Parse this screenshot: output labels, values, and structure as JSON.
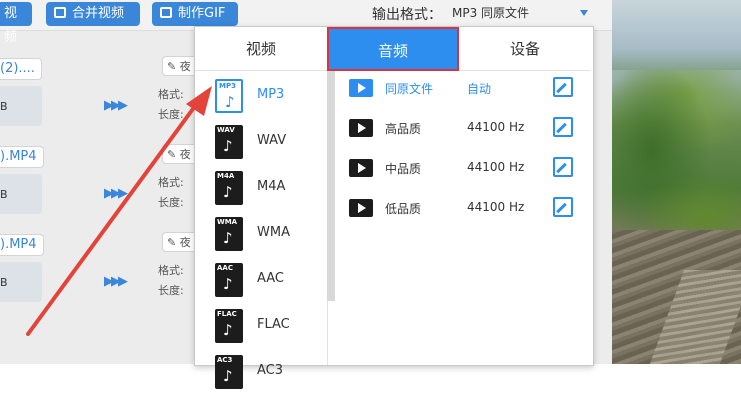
{
  "toolbar": {
    "btn_video": "视频",
    "btn_merge": "合并视频",
    "btn_gif": "制作GIF",
    "output_format_label": "输出格式：",
    "output_format_value": "MP3  同原文件"
  },
  "files": [
    {
      "name": "(2)....",
      "size": "B",
      "format_label": "格式:",
      "duration_label": "长度:",
      "edit": "夜"
    },
    {
      "name": ").MP4",
      "size": "B",
      "format_label": "格式:",
      "duration_label": "长度:",
      "edit": "夜"
    },
    {
      "name": ").MP4",
      "size": "B",
      "format_label": "格式:",
      "duration_label": "长度:",
      "edit": "夜"
    }
  ],
  "popup": {
    "tabs": [
      "视频",
      "音频",
      "设备"
    ],
    "active_tab": "音频",
    "formats": [
      {
        "tag": "MP3",
        "label": "MP3",
        "selected": true
      },
      {
        "tag": "WAV",
        "label": "WAV"
      },
      {
        "tag": "M4A",
        "label": "M4A"
      },
      {
        "tag": "WMA",
        "label": "WMA"
      },
      {
        "tag": "AAC",
        "label": "AAC"
      },
      {
        "tag": "FLAC",
        "label": "FLAC"
      },
      {
        "tag": "AC3",
        "label": "AC3"
      }
    ],
    "qualities": [
      {
        "name": "同原文件",
        "value": "自动",
        "selected": true
      },
      {
        "name": "高品质",
        "value": "44100 Hz"
      },
      {
        "name": "中品质",
        "value": "44100 Hz"
      },
      {
        "name": "低品质",
        "value": "44100 Hz"
      }
    ]
  },
  "colors": {
    "accent": "#2d8ef0",
    "highlight_border": "#d9343f",
    "arrow": "#e4433a"
  },
  "icons": {
    "format_badge": "music-note-icon",
    "quality": "film-icon",
    "edit": "edit-icon",
    "convert": "arrow-right-icon"
  }
}
